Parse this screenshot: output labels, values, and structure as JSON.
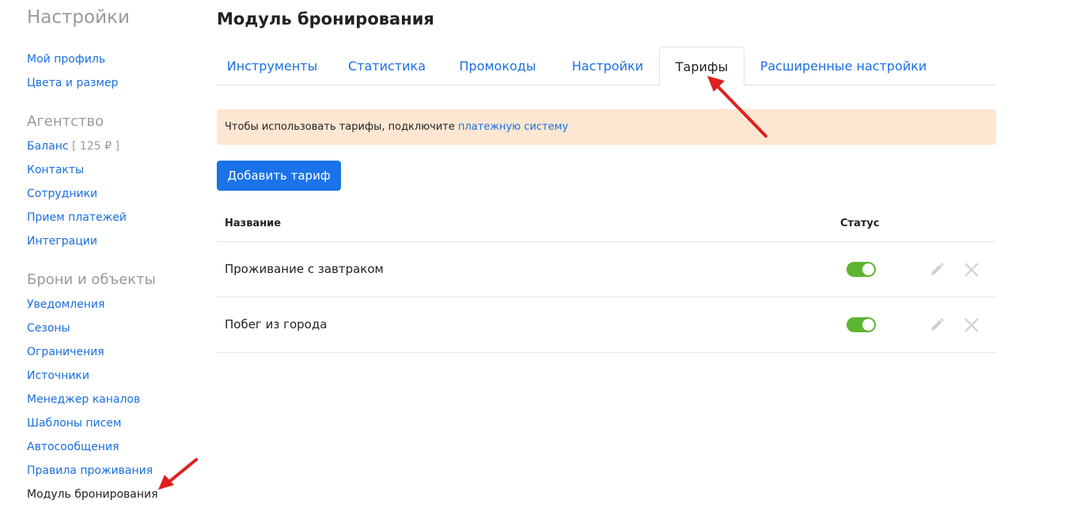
{
  "sidebar": {
    "title": "Настройки",
    "links_top": [
      {
        "label": "Мой профиль"
      },
      {
        "label": "Цвета и размер"
      }
    ],
    "agency": {
      "title": "Агентство",
      "balance_label": "Баланс",
      "balance_value": "[ 125 ₽ ]",
      "links": [
        {
          "label": "Контакты"
        },
        {
          "label": "Сотрудники"
        },
        {
          "label": "Прием платежей"
        },
        {
          "label": "Интеграции"
        }
      ]
    },
    "bookings": {
      "title": "Брони и объекты",
      "links": [
        {
          "label": "Уведомления"
        },
        {
          "label": "Сезоны"
        },
        {
          "label": "Ограничения"
        },
        {
          "label": "Источники"
        },
        {
          "label": "Менеджер каналов"
        },
        {
          "label": "Шаблоны писем"
        },
        {
          "label": "Автосообщения"
        },
        {
          "label": "Правила проживания"
        },
        {
          "label": "Модуль бронирования"
        }
      ],
      "active_index": 8
    }
  },
  "main": {
    "title": "Модуль бронирования",
    "tabs": [
      {
        "label": "Инструменты"
      },
      {
        "label": "Статистика"
      },
      {
        "label": "Промокоды"
      },
      {
        "label": "Настройки"
      },
      {
        "label": "Тарифы"
      },
      {
        "label": "Расширенные настройки"
      }
    ],
    "active_tab": 4,
    "notice": {
      "text": "Чтобы использовать тарифы, подключите ",
      "link": "платежную систему"
    },
    "add_button": "Добавить тариф",
    "table": {
      "headers": {
        "name": "Название",
        "status": "Статус"
      },
      "rows": [
        {
          "name": "Проживание с завтраком",
          "status_on": true
        },
        {
          "name": "Побег из города",
          "status_on": true
        }
      ]
    }
  },
  "colors": {
    "link": "#1a6fe0",
    "primary_button": "#1a73e8",
    "notice_bg": "#fde7d2",
    "toggle_on": "#5cb531",
    "annotation_arrow": "#e02020"
  },
  "icons": [
    "pencil-icon",
    "close-icon",
    "annotation-arrow"
  ]
}
